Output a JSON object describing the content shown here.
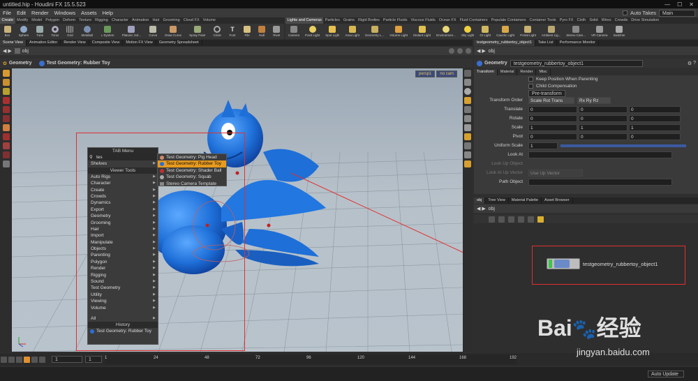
{
  "window": {
    "title": "untitled.hip - Houdini FX 15.5.523"
  },
  "menu": {
    "items": [
      "File",
      "Edit",
      "Render",
      "Windows",
      "Assets",
      "Help"
    ],
    "auto_takes": "Auto Takes",
    "desktop": "Main"
  },
  "shelf_left": {
    "tabs": [
      "Create",
      "Modify",
      "Model",
      "Polygon",
      "Deform",
      "Texture",
      "Rigging",
      "Character",
      "Animation",
      "Hair",
      "Grooming",
      "Cloud FX",
      "Volume"
    ],
    "tools": [
      "Box",
      "Sphere",
      "Tube",
      "Torus",
      "Grid",
      "Metaball",
      "L-System",
      "Platonic Sol...",
      "Curve",
      "Draw Curve",
      "Spray Paint",
      "Circle",
      "Font",
      "File",
      "Null",
      "Rivet"
    ]
  },
  "shelf_right": {
    "tabs": [
      "Lights and Cameras",
      "Particles",
      "Grains",
      "Rigid Bodies",
      "Particle Fluids",
      "Viscous Fluids",
      "Ocean FX",
      "Fluid Containers",
      "Populate Containers",
      "Container Tools",
      "Pyro FX",
      "Cloth",
      "Solid",
      "Wires",
      "Crowds",
      "Drive Simulation"
    ],
    "tools": [
      "Camera",
      "Point Light",
      "Spot Light",
      "Area Light",
      "Geometry L...",
      "Volume Light",
      "Distant Light",
      "Environmen...",
      "Sky Light",
      "GI Light",
      "Caustic Light",
      "Portal Light",
      "Ambient Lig...",
      "Stereo Cam...",
      "VR Camera",
      "Switcher"
    ]
  },
  "left_panes": {
    "tabs": [
      "Scene View",
      "Animation Editor",
      "Render View",
      "Composite View",
      "Motion FX View",
      "Geometry Spreadsheet"
    ],
    "path": "obj",
    "viewer_label": "Geometry",
    "viewer_node": "Test Geometry: Rubber Toy",
    "persp": "persp1",
    "cam": "no cam"
  },
  "param_pane": {
    "tabs": [
      "testgeometry_rubbertoy_object1",
      "Take List",
      "Performance Monitor"
    ],
    "path": "obj",
    "node_type": "Geometry",
    "node_name": "testgeometry_rubbertoy_object1",
    "subtabs": [
      "Transform",
      "Material",
      "Render",
      "Misc"
    ],
    "keep_position": "Keep Position When Parenting",
    "child_comp": "Child Compensation",
    "pretransform": "Pre-transform",
    "rows": [
      {
        "label": "Transform Order",
        "v": [
          "Scale Rot Trans",
          "Rx Ry Rz"
        ]
      },
      {
        "label": "Translate",
        "v": [
          "0",
          "0",
          "0"
        ]
      },
      {
        "label": "Rotate",
        "v": [
          "0",
          "0",
          "0"
        ]
      },
      {
        "label": "Scale",
        "v": [
          "1",
          "1",
          "1"
        ]
      },
      {
        "label": "Pivot",
        "v": [
          "0",
          "0",
          "0"
        ]
      },
      {
        "label": "Uniform Scale",
        "v": [
          "1"
        ]
      },
      {
        "label": "Look At",
        "v": [
          ""
        ]
      },
      {
        "label": "Look Up Object",
        "v": []
      },
      {
        "label": "Look At Up Vector",
        "v": [
          "Use Up Vector"
        ]
      },
      {
        "label": "Path Object",
        "v": [
          ""
        ]
      }
    ]
  },
  "network_pane": {
    "tabs": [
      "obj",
      "Tree View",
      "Material Palette",
      "Asset Browser"
    ],
    "path": "obj",
    "node_label": "testgeometry_rubbertoy_object1"
  },
  "tab_menu": {
    "title": "TAB Menu",
    "search": "tes",
    "shelves": "Shelves",
    "viewer_tools": "Viewer Tools",
    "items": [
      "Auto Rigs",
      "Character",
      "Create",
      "Crowds",
      "Dynamics",
      "Export",
      "Geometry",
      "Grooming",
      "Hair",
      "Import",
      "Manipulate",
      "Objects",
      "Parenting",
      "Polygon",
      "Render",
      "Rigging",
      "Sound",
      "Test Geometry",
      "Utility",
      "Viewing",
      "Volume"
    ],
    "all": "All",
    "history": "History",
    "history_item": "Test Geometry: Rubber Toy"
  },
  "submenu": {
    "items": [
      "Test Geometry: Pig Head",
      "Test Geometry: Rubber Toy",
      "Test Geometry: Shader Ball",
      "Test Geometry: Squab",
      "Stereo Camera Template"
    ],
    "highlighted": 1
  },
  "timeline": {
    "frame": "1",
    "start": "1",
    "ticks": [
      "1",
      "24",
      "48",
      "72",
      "96",
      "120",
      "144",
      "168",
      "192"
    ]
  },
  "status": {
    "auto_update": "Auto Update"
  },
  "watermark": {
    "brand": "Bai",
    "cn": "经验",
    "url": "jingyan.baidu.com"
  },
  "colors": {
    "highlight": "#e79a1e",
    "annotation": "#e0302e",
    "toy": "#1e6fd8"
  }
}
